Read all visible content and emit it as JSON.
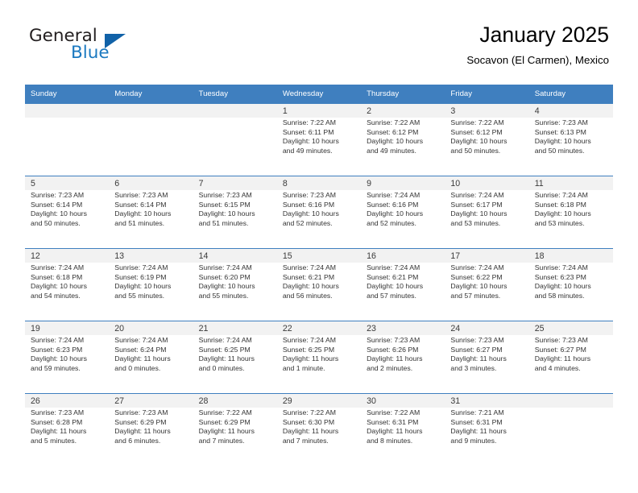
{
  "brand": {
    "word1": "General",
    "word2": "Blue",
    "triangle_color": "#1162a8",
    "blue_color": "#1b79c0"
  },
  "header": {
    "title": "January 2025",
    "subtitle": "Socavon (El Carmen), Mexico",
    "header_bg": "#3f7fbf",
    "cell_shade": "#f2f2f2"
  },
  "weekdays": [
    "Sunday",
    "Monday",
    "Tuesday",
    "Wednesday",
    "Thursday",
    "Friday",
    "Saturday"
  ],
  "weeks": [
    [
      {
        "day": "",
        "info": ""
      },
      {
        "day": "",
        "info": ""
      },
      {
        "day": "",
        "info": ""
      },
      {
        "day": "1",
        "info": "Sunrise: 7:22 AM\nSunset: 6:11 PM\nDaylight: 10 hours\nand 49 minutes."
      },
      {
        "day": "2",
        "info": "Sunrise: 7:22 AM\nSunset: 6:12 PM\nDaylight: 10 hours\nand 49 minutes."
      },
      {
        "day": "3",
        "info": "Sunrise: 7:22 AM\nSunset: 6:12 PM\nDaylight: 10 hours\nand 50 minutes."
      },
      {
        "day": "4",
        "info": "Sunrise: 7:23 AM\nSunset: 6:13 PM\nDaylight: 10 hours\nand 50 minutes."
      }
    ],
    [
      {
        "day": "5",
        "info": "Sunrise: 7:23 AM\nSunset: 6:14 PM\nDaylight: 10 hours\nand 50 minutes."
      },
      {
        "day": "6",
        "info": "Sunrise: 7:23 AM\nSunset: 6:14 PM\nDaylight: 10 hours\nand 51 minutes."
      },
      {
        "day": "7",
        "info": "Sunrise: 7:23 AM\nSunset: 6:15 PM\nDaylight: 10 hours\nand 51 minutes."
      },
      {
        "day": "8",
        "info": "Sunrise: 7:23 AM\nSunset: 6:16 PM\nDaylight: 10 hours\nand 52 minutes."
      },
      {
        "day": "9",
        "info": "Sunrise: 7:24 AM\nSunset: 6:16 PM\nDaylight: 10 hours\nand 52 minutes."
      },
      {
        "day": "10",
        "info": "Sunrise: 7:24 AM\nSunset: 6:17 PM\nDaylight: 10 hours\nand 53 minutes."
      },
      {
        "day": "11",
        "info": "Sunrise: 7:24 AM\nSunset: 6:18 PM\nDaylight: 10 hours\nand 53 minutes."
      }
    ],
    [
      {
        "day": "12",
        "info": "Sunrise: 7:24 AM\nSunset: 6:18 PM\nDaylight: 10 hours\nand 54 minutes."
      },
      {
        "day": "13",
        "info": "Sunrise: 7:24 AM\nSunset: 6:19 PM\nDaylight: 10 hours\nand 55 minutes."
      },
      {
        "day": "14",
        "info": "Sunrise: 7:24 AM\nSunset: 6:20 PM\nDaylight: 10 hours\nand 55 minutes."
      },
      {
        "day": "15",
        "info": "Sunrise: 7:24 AM\nSunset: 6:21 PM\nDaylight: 10 hours\nand 56 minutes."
      },
      {
        "day": "16",
        "info": "Sunrise: 7:24 AM\nSunset: 6:21 PM\nDaylight: 10 hours\nand 57 minutes."
      },
      {
        "day": "17",
        "info": "Sunrise: 7:24 AM\nSunset: 6:22 PM\nDaylight: 10 hours\nand 57 minutes."
      },
      {
        "day": "18",
        "info": "Sunrise: 7:24 AM\nSunset: 6:23 PM\nDaylight: 10 hours\nand 58 minutes."
      }
    ],
    [
      {
        "day": "19",
        "info": "Sunrise: 7:24 AM\nSunset: 6:23 PM\nDaylight: 10 hours\nand 59 minutes."
      },
      {
        "day": "20",
        "info": "Sunrise: 7:24 AM\nSunset: 6:24 PM\nDaylight: 11 hours\nand 0 minutes."
      },
      {
        "day": "21",
        "info": "Sunrise: 7:24 AM\nSunset: 6:25 PM\nDaylight: 11 hours\nand 0 minutes."
      },
      {
        "day": "22",
        "info": "Sunrise: 7:24 AM\nSunset: 6:25 PM\nDaylight: 11 hours\nand 1 minute."
      },
      {
        "day": "23",
        "info": "Sunrise: 7:23 AM\nSunset: 6:26 PM\nDaylight: 11 hours\nand 2 minutes."
      },
      {
        "day": "24",
        "info": "Sunrise: 7:23 AM\nSunset: 6:27 PM\nDaylight: 11 hours\nand 3 minutes."
      },
      {
        "day": "25",
        "info": "Sunrise: 7:23 AM\nSunset: 6:27 PM\nDaylight: 11 hours\nand 4 minutes."
      }
    ],
    [
      {
        "day": "26",
        "info": "Sunrise: 7:23 AM\nSunset: 6:28 PM\nDaylight: 11 hours\nand 5 minutes."
      },
      {
        "day": "27",
        "info": "Sunrise: 7:23 AM\nSunset: 6:29 PM\nDaylight: 11 hours\nand 6 minutes."
      },
      {
        "day": "28",
        "info": "Sunrise: 7:22 AM\nSunset: 6:29 PM\nDaylight: 11 hours\nand 7 minutes."
      },
      {
        "day": "29",
        "info": "Sunrise: 7:22 AM\nSunset: 6:30 PM\nDaylight: 11 hours\nand 7 minutes."
      },
      {
        "day": "30",
        "info": "Sunrise: 7:22 AM\nSunset: 6:31 PM\nDaylight: 11 hours\nand 8 minutes."
      },
      {
        "day": "31",
        "info": "Sunrise: 7:21 AM\nSunset: 6:31 PM\nDaylight: 11 hours\nand 9 minutes."
      },
      {
        "day": "",
        "info": ""
      }
    ]
  ]
}
